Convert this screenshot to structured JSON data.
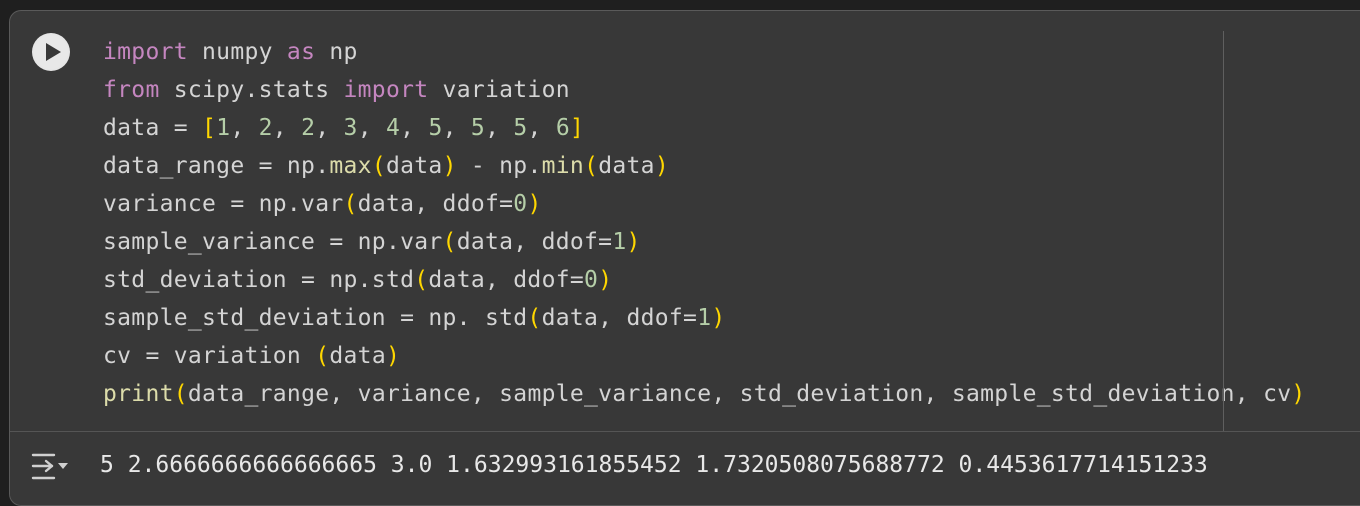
{
  "cell": {
    "run_icon": "play-icon",
    "code_lines": [
      [
        {
          "t": "import",
          "c": "kw"
        },
        {
          "t": " numpy ",
          "c": ""
        },
        {
          "t": "as",
          "c": "kw"
        },
        {
          "t": " np",
          "c": ""
        }
      ],
      [
        {
          "t": "from",
          "c": "kw"
        },
        {
          "t": " scipy.stats ",
          "c": ""
        },
        {
          "t": "import",
          "c": "kw"
        },
        {
          "t": " variation",
          "c": ""
        }
      ],
      [
        {
          "t": "data = ",
          "c": ""
        },
        {
          "t": "[",
          "c": "br"
        },
        {
          "t": "1",
          "c": "num"
        },
        {
          "t": ", ",
          "c": ""
        },
        {
          "t": "2",
          "c": "num"
        },
        {
          "t": ", ",
          "c": ""
        },
        {
          "t": "2",
          "c": "num"
        },
        {
          "t": ", ",
          "c": ""
        },
        {
          "t": "3",
          "c": "num"
        },
        {
          "t": ", ",
          "c": ""
        },
        {
          "t": "4",
          "c": "num"
        },
        {
          "t": ", ",
          "c": ""
        },
        {
          "t": "5",
          "c": "num"
        },
        {
          "t": ", ",
          "c": ""
        },
        {
          "t": "5",
          "c": "num"
        },
        {
          "t": ", ",
          "c": ""
        },
        {
          "t": "5",
          "c": "num"
        },
        {
          "t": ", ",
          "c": ""
        },
        {
          "t": "6",
          "c": "num"
        },
        {
          "t": "]",
          "c": "br"
        }
      ],
      [
        {
          "t": "data_range = np.",
          "c": ""
        },
        {
          "t": "max",
          "c": "fn"
        },
        {
          "t": "(",
          "c": "br"
        },
        {
          "t": "data",
          "c": ""
        },
        {
          "t": ")",
          "c": "br"
        },
        {
          "t": " - np.",
          "c": ""
        },
        {
          "t": "min",
          "c": "fn"
        },
        {
          "t": "(",
          "c": "br"
        },
        {
          "t": "data",
          "c": ""
        },
        {
          "t": ")",
          "c": "br"
        }
      ],
      [
        {
          "t": "variance = np.var",
          "c": ""
        },
        {
          "t": "(",
          "c": "br"
        },
        {
          "t": "data, ddof=",
          "c": ""
        },
        {
          "t": "0",
          "c": "num"
        },
        {
          "t": ")",
          "c": "br"
        }
      ],
      [
        {
          "t": "sample_variance = np.var",
          "c": ""
        },
        {
          "t": "(",
          "c": "br"
        },
        {
          "t": "data, ddof=",
          "c": ""
        },
        {
          "t": "1",
          "c": "num"
        },
        {
          "t": ")",
          "c": "br"
        }
      ],
      [
        {
          "t": "std_deviation = np.std",
          "c": ""
        },
        {
          "t": "(",
          "c": "br"
        },
        {
          "t": "data, ddof=",
          "c": ""
        },
        {
          "t": "0",
          "c": "num"
        },
        {
          "t": ")",
          "c": "br"
        }
      ],
      [
        {
          "t": "sample_std_deviation = np. std",
          "c": ""
        },
        {
          "t": "(",
          "c": "br"
        },
        {
          "t": "data, ddof=",
          "c": ""
        },
        {
          "t": "1",
          "c": "num"
        },
        {
          "t": ")",
          "c": "br"
        }
      ],
      [
        {
          "t": "cv = variation ",
          "c": ""
        },
        {
          "t": "(",
          "c": "br"
        },
        {
          "t": "data",
          "c": ""
        },
        {
          "t": ")",
          "c": "br"
        }
      ],
      [
        {
          "t": "print",
          "c": "fn"
        },
        {
          "t": "(",
          "c": "br"
        },
        {
          "t": "data_range, variance, sample_variance, std_deviation, sample_std_deviation, cv",
          "c": ""
        },
        {
          "t": ")",
          "c": "br"
        }
      ]
    ]
  },
  "output": {
    "icon": "output-toggle-icon",
    "text": "5 2.6666666666666665 3.0 1.632993161855452 1.7320508075688772 0.4453617714151233"
  },
  "colors": {
    "background": "#383838",
    "keyword": "#c586c0",
    "number": "#b5cea8",
    "bracket": "#ffd700",
    "function": "#dcdcaa",
    "text": "#d4d4d4"
  }
}
